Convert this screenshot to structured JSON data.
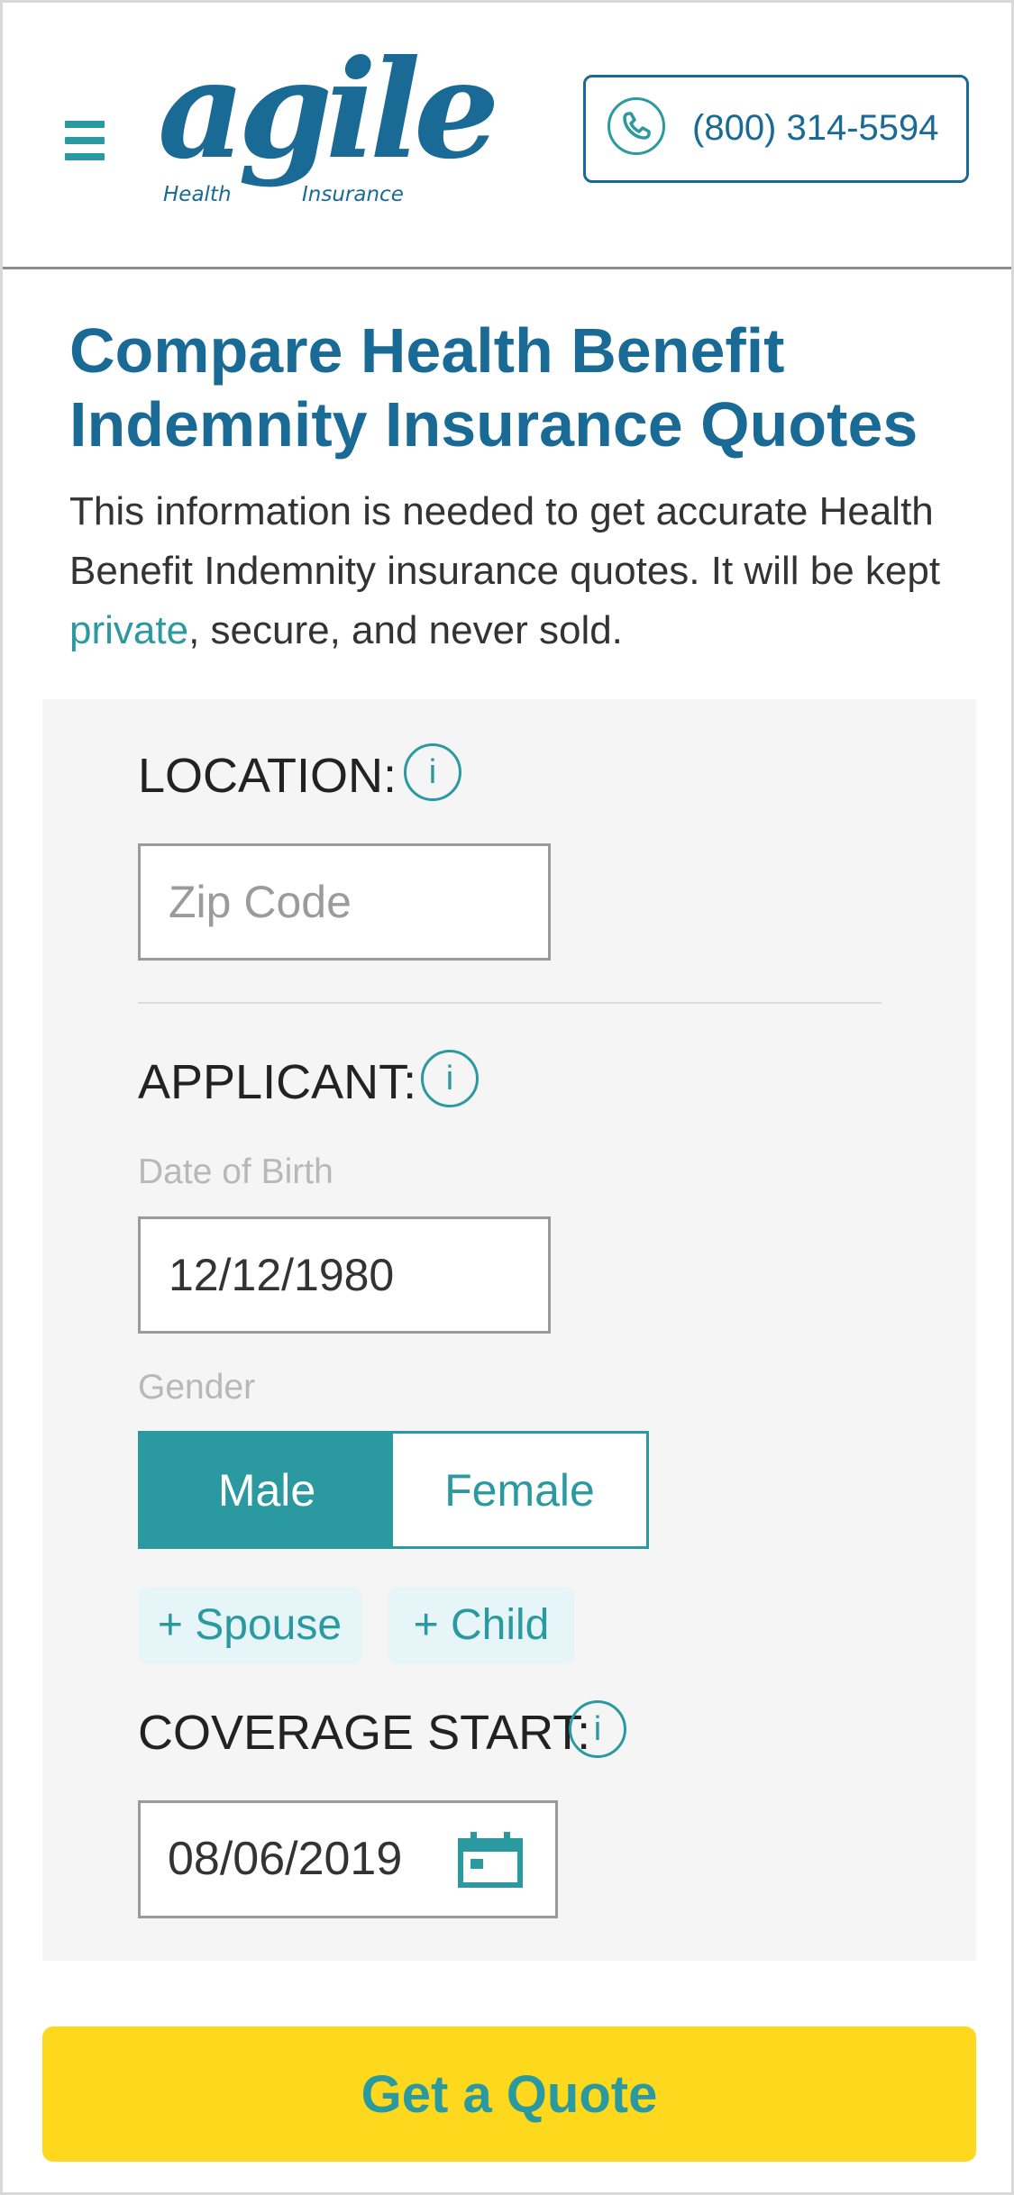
{
  "header": {
    "menu_icon": "hamburger-menu-icon",
    "logo": {
      "word": "agile",
      "registered": "®",
      "sub_left": "Health",
      "sub_right": "Insurance"
    },
    "phone": {
      "label": "(800) 314-5594",
      "icon": "phone-icon"
    }
  },
  "page": {
    "title": "Compare Health Benefit Indemnity Insurance Quotes",
    "intro_before": "This information is needed to get accurate Health Benefit Indemnity insurance quotes. It will be kept ",
    "intro_link": "private",
    "intro_after": ", secure, and never sold."
  },
  "form": {
    "location": {
      "label": "LOCATION:",
      "info_icon": "i",
      "zip_placeholder": "Zip Code",
      "zip_value": ""
    },
    "applicant": {
      "label": "APPLICANT:",
      "info_icon": "i",
      "dob_label": "Date of Birth",
      "dob_value": "12/12/1980",
      "gender_label": "Gender",
      "gender_options": [
        "Male",
        "Female"
      ],
      "gender_selected": "Male",
      "add_spouse": "+ Spouse",
      "add_child": "+ Child"
    },
    "coverage": {
      "label": "COVERAGE START:",
      "info_icon": "i",
      "start_date": "08/06/2019",
      "calendar_icon": "calendar-icon"
    }
  },
  "cta": {
    "label": "Get a Quote"
  },
  "colors": {
    "brand_blue": "#1a6a96",
    "teal": "#2a9aa0",
    "cta_yellow": "#fdd81c",
    "form_bg": "#f5f5f5"
  }
}
